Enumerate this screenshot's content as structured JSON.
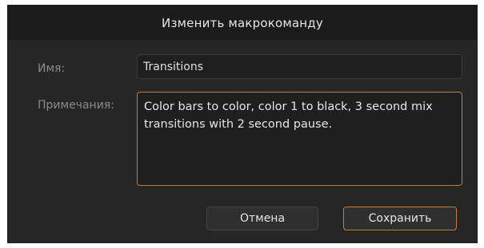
{
  "dialog": {
    "title": "Изменить макрокоманду",
    "name_label": "Имя:",
    "name_value": "Transitions",
    "notes_label": "Примечания:",
    "notes_value": "Color bars to color, color 1 to black, 3 second mix transitions with 2 second pause.",
    "cancel_label": "Отмена",
    "save_label": "Сохранить"
  },
  "colors": {
    "background": "#262626",
    "title_bar": "#1b1b1b",
    "field": "#1f1f1f",
    "focus_accent": "#c37a34",
    "label_text": "#8a8a8a",
    "text": "#e6e6e6"
  }
}
